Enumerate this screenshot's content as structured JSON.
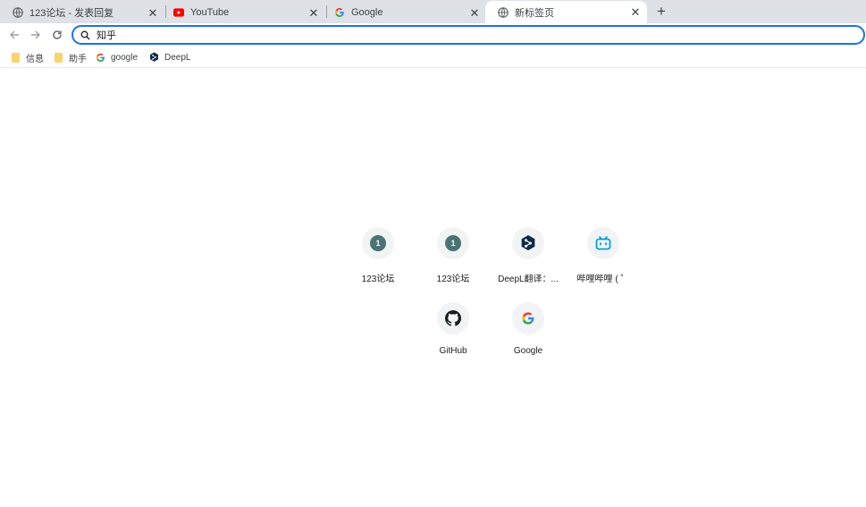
{
  "tabs": [
    {
      "title": "123论坛 - 发表回复",
      "icon": "globe-icon"
    },
    {
      "title": "YouTube",
      "icon": "youtube-icon"
    },
    {
      "title": "Google",
      "icon": "google-icon"
    },
    {
      "title": "新标签页",
      "icon": "globe-icon",
      "active": true
    }
  ],
  "omnibox": {
    "value": "知乎"
  },
  "bookmarks": [
    {
      "label": "信息",
      "icon": "folder-icon"
    },
    {
      "label": "助手",
      "icon": "folder-icon"
    },
    {
      "label": "google",
      "icon": "google-icon"
    },
    {
      "label": "DeepL",
      "icon": "deepl-icon"
    }
  ],
  "shortcuts": [
    {
      "label": "123论坛",
      "icon": "number-1-icon",
      "glyph": "1"
    },
    {
      "label": "123论坛",
      "icon": "number-1-icon",
      "glyph": "1"
    },
    {
      "label": "DeepL翻译：...",
      "icon": "deepl-icon"
    },
    {
      "label": "哔哩哔哩 ( ゜",
      "icon": "bilibili-icon"
    },
    {
      "label": "GitHub",
      "icon": "github-icon"
    },
    {
      "label": "Google",
      "icon": "google-icon"
    }
  ],
  "colors": {
    "accent": "#1a73e8",
    "tabstrip": "#dee1e6",
    "youtube": "#ff0000",
    "bilibili": "#00a1d6",
    "deepl": "#0f2b46"
  }
}
